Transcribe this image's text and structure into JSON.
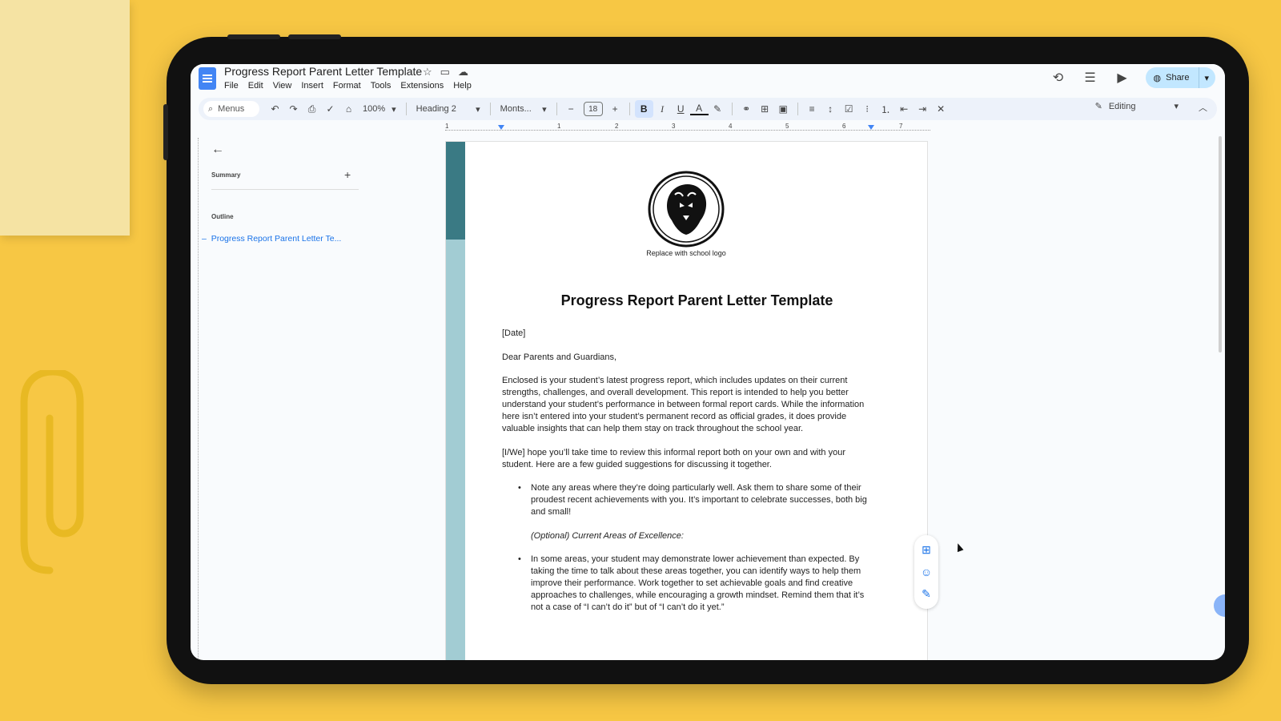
{
  "doc": {
    "title": "Progress Report Parent Letter Template",
    "menu": [
      "File",
      "Edit",
      "View",
      "Insert",
      "Format",
      "Tools",
      "Extensions",
      "Help"
    ]
  },
  "header": {
    "share_label": "Share"
  },
  "toolbar": {
    "search_label": "Menus",
    "zoom": "100%",
    "style": "Heading 2",
    "font": "Monts...",
    "font_size": "18",
    "bold": "B",
    "italic": "I",
    "underline": "U",
    "text_color": "A",
    "mode": "Editing"
  },
  "ruler": {
    "numbers": [
      "1",
      "1",
      "2",
      "3",
      "4",
      "5",
      "6",
      "7"
    ]
  },
  "left_panel": {
    "summary_label": "Summary",
    "outline_label": "Outline",
    "outline_items": [
      "Progress Report Parent Letter Te..."
    ]
  },
  "page": {
    "logo_caption": "Replace with school logo",
    "heading": "Progress Report Parent Letter Template",
    "date": "[Date]",
    "greeting": "Dear Parents and Guardians,",
    "para1": "Enclosed is your student’s latest progress report, which includes updates on their current strengths, challenges, and overall development. This report is intended to help you better understand your student’s performance in between formal report cards. While the information here isn’t entered into your student’s permanent record as official grades, it does provide valuable insights that can help them stay on track throughout the school year.",
    "para2": "[I/We] hope you’ll take time to review this informal report both on your own and with your student. Here are a few guided suggestions for discussing it together.",
    "bullet1": "Note any areas where they’re doing particularly well. Ask them to share some of their proudest recent achievements with you. It’s important to celebrate successes, both big and small!",
    "optional": "(Optional) Current Areas of Excellence:",
    "bullet2": "In some areas, your student may demonstrate lower achievement than expected. By taking the time to talk about these areas together, you can identify ways to help them improve their performance. Work together to set achievable goals and find creative approaches to challenges, while encouraging a growth mindset. Remind them that it’s not a case of “I can’t do it” but of “I can’t do it yet.”"
  },
  "colors": {
    "desk": "#f7c744",
    "accent_blue": "#1a73e8",
    "band_dark": "#3a7a84",
    "band_light": "#a2ccd3",
    "share_bg": "#c2e7ff"
  }
}
